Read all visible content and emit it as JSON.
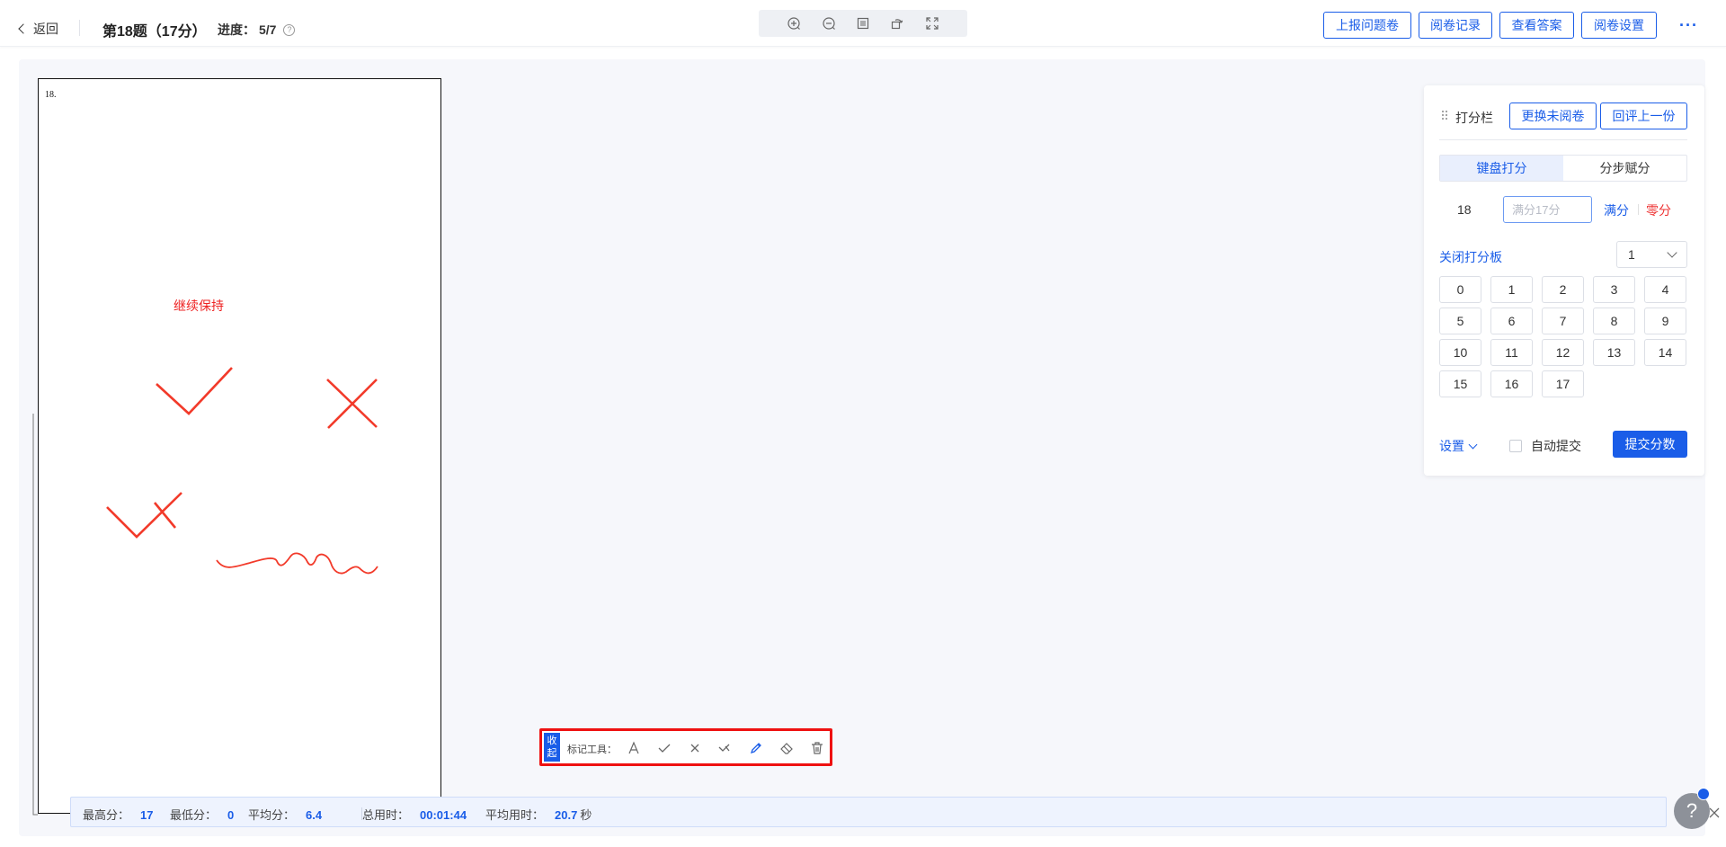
{
  "header": {
    "back_label": "返回",
    "question_title": "第18题（17分）",
    "progress_label": "进度：",
    "progress_value": "5/7",
    "buttons": {
      "report": "上报问题卷",
      "records": "阅卷记录",
      "answer": "查看答案",
      "settings": "阅卷设置"
    },
    "more": "···"
  },
  "zoom_tools": [
    "zoom-in-icon",
    "zoom-out-icon",
    "fit-page-icon",
    "rotate-icon",
    "fullscreen-icon"
  ],
  "paper": {
    "question_number": "18.",
    "comment": "继续保持"
  },
  "score_panel": {
    "title": "打分栏",
    "change_button": "更换未阅卷",
    "review_prev_button": "回评上一份",
    "tabs": [
      {
        "label": "键盘打分",
        "active": true
      },
      {
        "label": "分步赋分",
        "active": false
      }
    ],
    "question_no": "18",
    "score_placeholder": "满分17分",
    "full_label": "满分",
    "zero_label": "零分",
    "close_board": "关闭打分板",
    "step_value": "1",
    "keys": [
      "0",
      "1",
      "2",
      "3",
      "4",
      "5",
      "6",
      "7",
      "8",
      "9",
      "10",
      "11",
      "12",
      "13",
      "14",
      "15",
      "16",
      "17"
    ],
    "settings_label": "设置",
    "auto_submit": "自动提交",
    "submit": "提交分数"
  },
  "toolbar": {
    "collapse": [
      "收",
      "起"
    ],
    "label": "标记工具：",
    "tools": [
      "text-icon",
      "check-icon",
      "cross-icon",
      "half-check-icon",
      "pen-icon",
      "eraser-icon",
      "trash-icon"
    ]
  },
  "stats": {
    "max_label": "最高分：",
    "max_value": "17",
    "min_label": "最低分：",
    "min_value": "0",
    "avg_label": "平均分：",
    "avg_value": "6.4",
    "total_time_label": "总用时：",
    "total_time_value": "00:01:44",
    "avg_time_label": "平均用时：",
    "avg_time_value": "20.7",
    "avg_time_unit": "秒"
  },
  "help_fab": "?",
  "colors": {
    "primary": "#1a5de8",
    "mark_red": "#ee2222"
  }
}
